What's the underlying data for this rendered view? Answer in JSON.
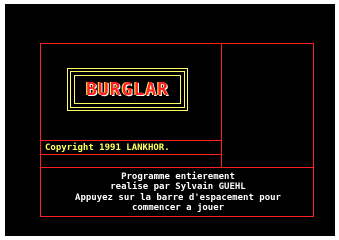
{
  "game": {
    "title_logo": "BURGLAR",
    "copyright": "Copyright 1991 LANKHOR.",
    "credit_line1": "Programme entierement",
    "credit_line2": "realise par Sylvain GUEHL",
    "instruction_line1": "Appuyez sur la barre d'espacement pour",
    "instruction_line2": "commencer a jouer"
  },
  "colors": {
    "background": "#000000",
    "frame": "#ff2020",
    "logo_border": "#ffff60",
    "logo_text": "#ff2020",
    "copyright_text": "#ffff60",
    "body_text": "#ffffff"
  }
}
